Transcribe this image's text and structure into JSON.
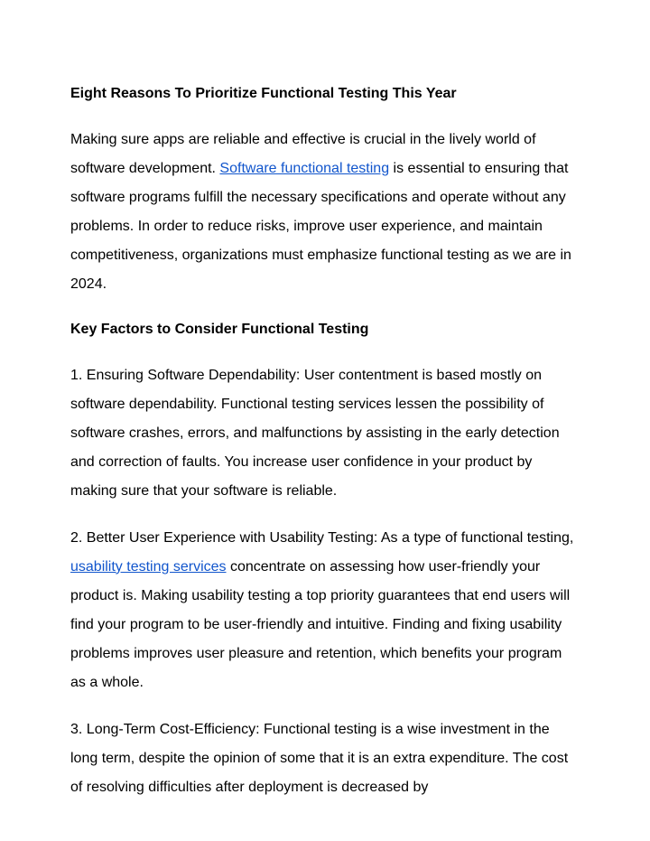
{
  "title": "Eight Reasons To Prioritize Functional Testing This Year",
  "intro": {
    "pre": "Making sure apps are reliable and effective is crucial in the lively world of software development. ",
    "link": "Software functional testing",
    "post": " is essential to ensuring that software programs fulfill the necessary specifications and operate without any problems. In order to reduce risks, improve user experience, and maintain competitiveness, organizations must emphasize functional testing as we are in 2024."
  },
  "subhead": "Key Factors to Consider Functional Testing",
  "p1": "1. Ensuring Software Dependability: User contentment is based mostly on software dependability. Functional testing services lessen the possibility of software crashes, errors, and malfunctions by assisting in the early detection and correction of faults. You increase user confidence in your product by making sure that your software is reliable.",
  "p2": {
    "pre": "2. Better User Experience with Usability Testing: As a type of functional testing, ",
    "link": "usability testing services",
    "post": " concentrate on assessing how user-friendly your product is. Making usability testing a top priority guarantees that end users will find your program to be user-friendly and intuitive. Finding and fixing usability problems improves user pleasure and retention, which benefits your program as a whole."
  },
  "p3": "3. Long-Term Cost-Efficiency: Functional testing is a wise investment in the long term, despite the opinion of some that it is an extra expenditure. The cost of resolving difficulties after deployment is decreased by"
}
